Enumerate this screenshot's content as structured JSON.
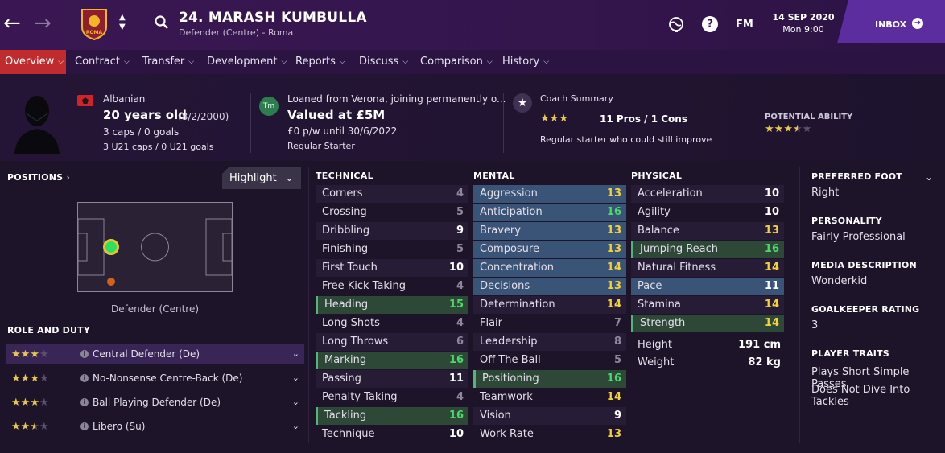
{
  "header": {
    "title": "24. MARASH KUMBULLA",
    "subtitle": "Defender (Centre) - Roma",
    "club_badge_text": "ROMA",
    "fm_label": "FM",
    "date": "14 SEP 2020",
    "day_time": "Mon 9:00",
    "inbox_label": "INBOX"
  },
  "tabs": [
    {
      "label": "Overview"
    },
    {
      "label": "Contract"
    },
    {
      "label": "Transfer"
    },
    {
      "label": "Development"
    },
    {
      "label": "Reports"
    },
    {
      "label": "Discuss"
    },
    {
      "label": "Comparison"
    },
    {
      "label": "History"
    }
  ],
  "player": {
    "nationality": "Albanian",
    "age": "20 years old",
    "dob": "(8/2/2000)",
    "caps": "3 caps / 0 goals",
    "u21_caps": "3 U21 caps / 0 U21 goals"
  },
  "contract": {
    "badge_text": "Tm",
    "loan_status": "Loaned from Verona, joining permanently o...",
    "value": "Valued at £5M",
    "wage": "£0 p/w until 30/6/2022",
    "squad_status": "Regular Starter"
  },
  "coach": {
    "label": "Coach Summary",
    "stars": 3,
    "pros_cons": "11 Pros / 1 Cons",
    "summary": "Regular starter who could still improve"
  },
  "potential": {
    "label": "POTENTIAL ABILITY",
    "stars": 3.5
  },
  "positions": {
    "label": "POSITIONS",
    "highlight_label": "Highlight",
    "position_name": "Defender (Centre)"
  },
  "roles": {
    "label": "ROLE AND DUTY",
    "items": [
      {
        "name": "Central Defender (De)",
        "stars": 3
      },
      {
        "name": "No-Nonsense Centre-Back (De)",
        "stars": 3
      },
      {
        "name": "Ball Playing Defender (De)",
        "stars": 3
      },
      {
        "name": "Libero (Su)",
        "stars": 2.5
      }
    ]
  },
  "technical": {
    "label": "TECHNICAL",
    "items": [
      {
        "name": "Corners",
        "value": "4"
      },
      {
        "name": "Crossing",
        "value": "5"
      },
      {
        "name": "Dribbling",
        "value": "9"
      },
      {
        "name": "Finishing",
        "value": "5"
      },
      {
        "name": "First Touch",
        "value": "10"
      },
      {
        "name": "Free Kick Taking",
        "value": "4"
      },
      {
        "name": "Heading",
        "value": "15"
      },
      {
        "name": "Long Shots",
        "value": "4"
      },
      {
        "name": "Long Throws",
        "value": "6"
      },
      {
        "name": "Marking",
        "value": "16"
      },
      {
        "name": "Passing",
        "value": "11"
      },
      {
        "name": "Penalty Taking",
        "value": "4"
      },
      {
        "name": "Tackling",
        "value": "16"
      },
      {
        "name": "Technique",
        "value": "10"
      }
    ]
  },
  "mental": {
    "label": "MENTAL",
    "items": [
      {
        "name": "Aggression",
        "value": "13"
      },
      {
        "name": "Anticipation",
        "value": "16"
      },
      {
        "name": "Bravery",
        "value": "13"
      },
      {
        "name": "Composure",
        "value": "13"
      },
      {
        "name": "Concentration",
        "value": "14"
      },
      {
        "name": "Decisions",
        "value": "13"
      },
      {
        "name": "Determination",
        "value": "14"
      },
      {
        "name": "Flair",
        "value": "7"
      },
      {
        "name": "Leadership",
        "value": "8"
      },
      {
        "name": "Off The Ball",
        "value": "5"
      },
      {
        "name": "Positioning",
        "value": "16"
      },
      {
        "name": "Teamwork",
        "value": "14"
      },
      {
        "name": "Vision",
        "value": "9"
      },
      {
        "name": "Work Rate",
        "value": "13"
      }
    ]
  },
  "physical": {
    "label": "PHYSICAL",
    "items": [
      {
        "name": "Acceleration",
        "value": "10"
      },
      {
        "name": "Agility",
        "value": "10"
      },
      {
        "name": "Balance",
        "value": "13"
      },
      {
        "name": "Jumping Reach",
        "value": "16"
      },
      {
        "name": "Natural Fitness",
        "value": "14"
      },
      {
        "name": "Pace",
        "value": "11"
      },
      {
        "name": "Stamina",
        "value": "14"
      },
      {
        "name": "Strength",
        "value": "14"
      }
    ],
    "height_label": "Height",
    "height": "191 cm",
    "weight_label": "Weight",
    "weight": "82 kg"
  },
  "sidebar": {
    "preferred_foot_label": "PREFERRED FOOT",
    "preferred_foot": "Right",
    "personality_label": "PERSONALITY",
    "personality": "Fairly Professional",
    "media_label": "MEDIA DESCRIPTION",
    "media": "Wonderkid",
    "gk_label": "GOALKEEPER RATING",
    "gk_rating": "3",
    "traits_label": "PLAYER TRAITS",
    "traits": [
      "Plays Short Simple Passes",
      "Does Not Dive Into Tackles"
    ]
  },
  "colors": {
    "accent_red": "#c02c2e",
    "inbox_purple": "#5b2d9e",
    "highlight_green": "#4cd968",
    "highlight_yellow": "#f2d23c"
  }
}
